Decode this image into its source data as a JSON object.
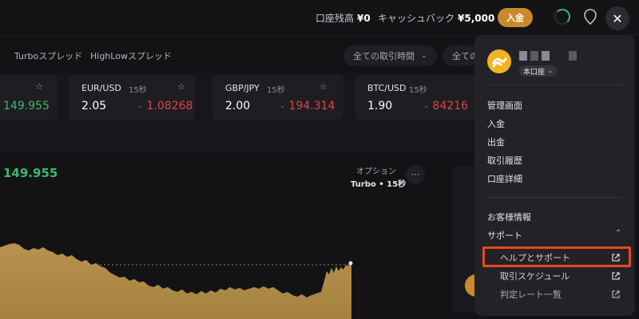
{
  "header": {
    "balance_label": "口座残高",
    "balance_value": "¥0",
    "cashback_label": "キャッシュバック",
    "cashback_value": "¥5,000",
    "deposit_button": "入金",
    "close_symbol": "✕"
  },
  "filters": {
    "tabs": [
      "Turboスプレッド",
      "HighLowスプレッド"
    ],
    "trading_time_select": "全ての取引時間",
    "second_select": "全ての"
  },
  "tickers": [
    {
      "symbol": "",
      "duration": "",
      "payout": "",
      "rate": "149.955",
      "rate_color": "#3fb86b"
    },
    {
      "symbol": "EUR/USD",
      "duration": "15秒",
      "payout": "2.05",
      "rate": "1.08268",
      "rate_color": "#e0424a"
    },
    {
      "symbol": "GBP/JPY",
      "duration": "15秒",
      "payout": "2.00",
      "rate": "194.314",
      "rate_color": "#e0424a"
    },
    {
      "symbol": "BTC/USD",
      "duration": "15秒",
      "payout": "1.90",
      "rate": "84216",
      "rate_color": "#e0424a"
    }
  ],
  "chart_area": {
    "current_price": "149.955",
    "option_label": "オプション",
    "option_type": "Turbo • 15秒",
    "more_symbol": "···"
  },
  "menu": {
    "account_type": "本口座",
    "items": [
      "管理画面",
      "入金",
      "出金",
      "取引履歴",
      "口座詳細"
    ],
    "customer_info": "お客様情報",
    "support": "サポート",
    "support_items": [
      "ヘルプとサポート",
      "取引スケジュール",
      "判定レート一覧"
    ]
  },
  "colors": {
    "accent": "#c98a2c",
    "up": "#3fb86b",
    "down": "#e0424a",
    "highlight": "#e8481d"
  }
}
